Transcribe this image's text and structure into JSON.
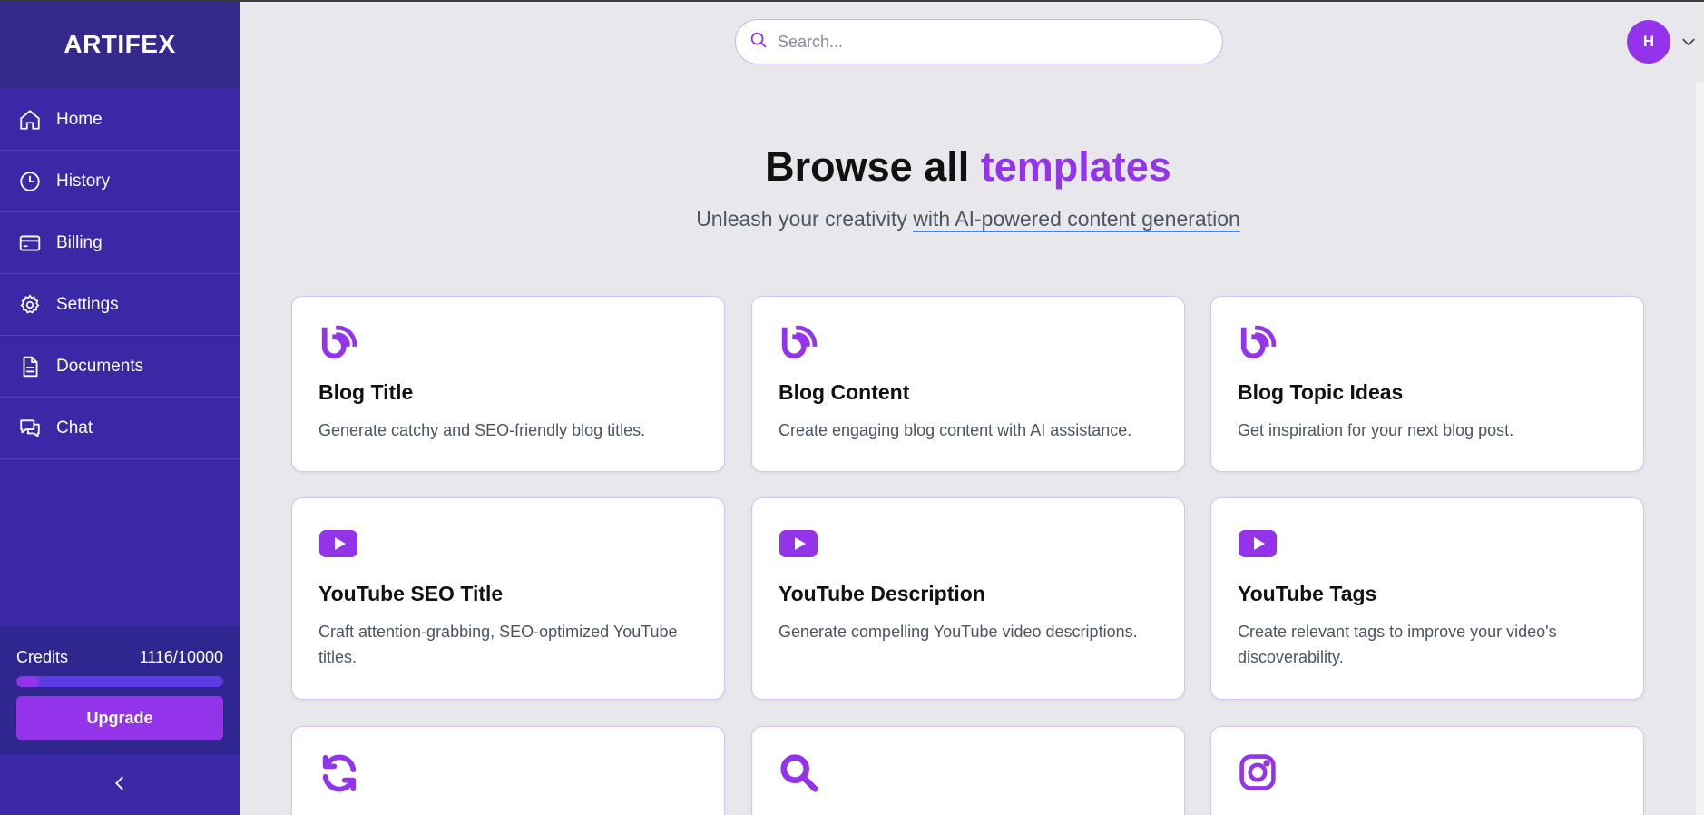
{
  "sidebar": {
    "brand": "ARTIFEX",
    "items": [
      {
        "label": "Home",
        "icon": "home-icon"
      },
      {
        "label": "History",
        "icon": "clock-icon"
      },
      {
        "label": "Billing",
        "icon": "credit-card-icon"
      },
      {
        "label": "Settings",
        "icon": "gear-icon"
      },
      {
        "label": "Documents",
        "icon": "document-icon"
      },
      {
        "label": "Chat",
        "icon": "chat-icon"
      }
    ],
    "credits_label": "Credits",
    "credits_value": "1116/10000",
    "credits_fraction": 0.1116,
    "upgrade_label": "Upgrade",
    "collapse_icon": "chevron-left-icon"
  },
  "header": {
    "search_placeholder": "Search...",
    "avatar_initial": "H"
  },
  "hero": {
    "title_main": "Browse all",
    "title_accent": "templates",
    "subtitle_plain": "Unleash your creativity",
    "subtitle_link": "with AI-powered content generation"
  },
  "templates": [
    {
      "title": "Blog Title",
      "desc": "Generate catchy and SEO-friendly blog titles.",
      "icon": "blog-icon"
    },
    {
      "title": "Blog Content",
      "desc": "Create engaging blog content with AI assistance.",
      "icon": "blog-icon"
    },
    {
      "title": "Blog Topic Ideas",
      "desc": "Get inspiration for your next blog post.",
      "icon": "blog-icon"
    },
    {
      "title": "YouTube SEO Title",
      "desc": "Craft attention-grabbing, SEO-optimized YouTube titles.",
      "icon": "youtube-icon"
    },
    {
      "title": "YouTube Description",
      "desc": "Generate compelling YouTube video descriptions.",
      "icon": "youtube-icon"
    },
    {
      "title": "YouTube Tags",
      "desc": "Create relevant tags to improve your video's discoverability.",
      "icon": "youtube-icon"
    },
    {
      "icon": "refresh-icon"
    },
    {
      "icon": "search-icon"
    },
    {
      "icon": "instagram-icon"
    }
  ],
  "colors": {
    "accent": "#9333ea",
    "sidebar": "#3b28a6",
    "background": "#e7e7ec"
  }
}
